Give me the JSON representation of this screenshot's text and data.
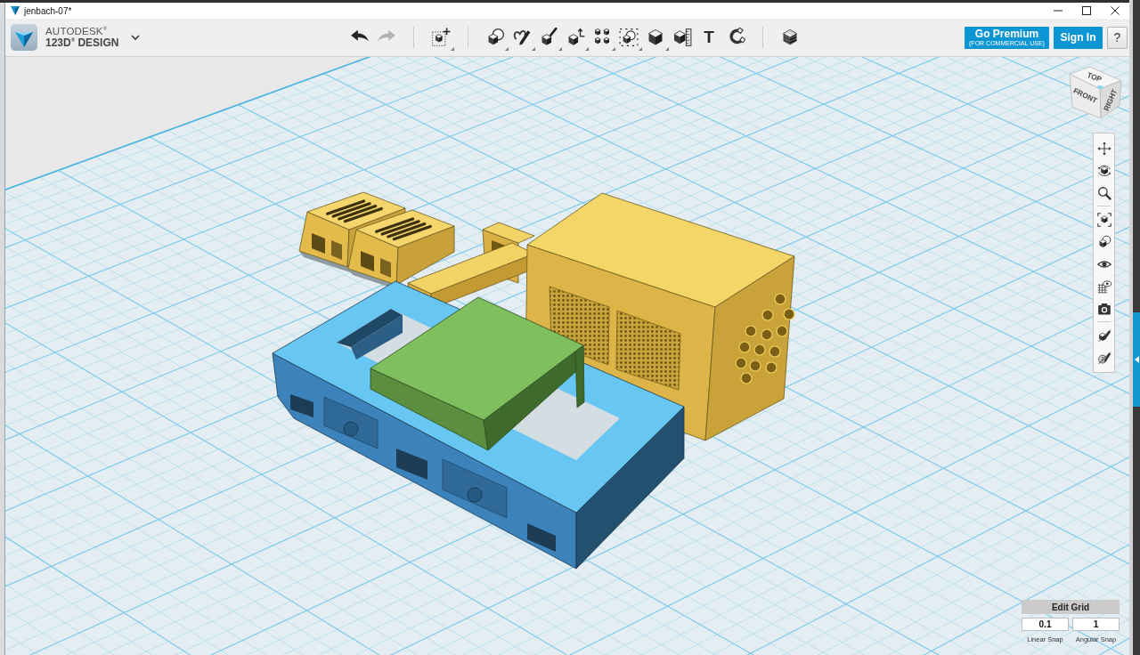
{
  "window": {
    "title": "jenbach-07*"
  },
  "brand": {
    "line_1": "AUTODESK$^{®}$",
    "line_2": "123D$^{®}$ DESIGN"
  },
  "toolbar": {
    "groups": [
      [
        {
          "kind": "undo",
          "menu": false,
          "disabled": false
        },
        {
          "kind": "redo",
          "menu": false,
          "disabled": true
        }
      ],
      [
        {
          "kind": "transform",
          "menu": true,
          "disabled": false
        }
      ],
      [
        {
          "kind": "primitives",
          "menu": true,
          "disabled": false
        },
        {
          "kind": "sketch",
          "menu": true,
          "disabled": false
        },
        {
          "kind": "construct",
          "menu": true,
          "disabled": false
        },
        {
          "kind": "modify",
          "menu": true,
          "disabled": false
        },
        {
          "kind": "pattern",
          "menu": true,
          "disabled": false
        },
        {
          "kind": "grouping",
          "menu": true,
          "disabled": false
        },
        {
          "kind": "combine",
          "menu": true,
          "disabled": false
        },
        {
          "kind": "measure",
          "menu": false,
          "disabled": false
        },
        {
          "kind": "text",
          "glyph": "T",
          "menu": false,
          "disabled": false
        },
        {
          "kind": "snap",
          "menu": false,
          "disabled": false
        }
      ],
      [
        {
          "kind": "materials",
          "menu": false,
          "disabled": false
        }
      ]
    ]
  },
  "header_buttons": {
    "premium": {
      "label": "Go Premium",
      "note": "(FOR COMMERCIAL USE)"
    },
    "sign_in": {
      "label": "Sign In"
    },
    "help": {
      "label": "?"
    }
  },
  "view_cube": {
    "top": "TOP",
    "front": "FRONT",
    "right": "RIGHT"
  },
  "navigation": {
    "groups": [
      [
        {
          "kind": "pan"
        },
        {
          "kind": "orbit"
        },
        {
          "kind": "zoom"
        }
      ],
      [
        {
          "kind": "fit"
        },
        {
          "kind": "zoom_selected"
        },
        {
          "kind": "visibility"
        },
        {
          "kind": "outlines"
        },
        {
          "kind": "snapshot"
        }
      ],
      [
        {
          "kind": "hide_sketch"
        },
        {
          "kind": "hide_mesh"
        }
      ]
    ]
  },
  "edit_grid": {
    "title": "Edit Grid",
    "fields": [
      {
        "value": "0.1",
        "label": "Linear Snap"
      },
      {
        "value": "1",
        "label": "Angular Snap"
      }
    ]
  }
}
